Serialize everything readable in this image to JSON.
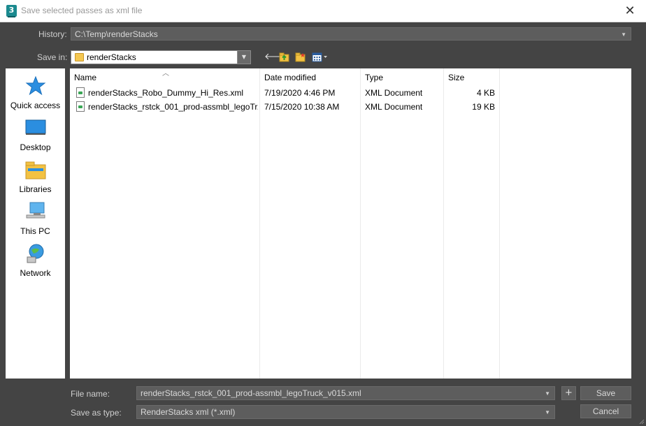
{
  "window": {
    "title": "Save selected passes as xml file",
    "close_glyph": "✕"
  },
  "history": {
    "label": "History:",
    "value": "C:\\Temp\\renderStacks"
  },
  "save_in": {
    "label": "Save in:",
    "value": "renderStacks"
  },
  "places": [
    {
      "label": "Quick access",
      "icon": "star-icon"
    },
    {
      "label": "Desktop",
      "icon": "desktop-icon"
    },
    {
      "label": "Libraries",
      "icon": "libraries-icon"
    },
    {
      "label": "This PC",
      "icon": "this-pc-icon"
    },
    {
      "label": "Network",
      "icon": "network-icon"
    }
  ],
  "columns": {
    "name": "Name",
    "date": "Date modified",
    "type": "Type",
    "size": "Size"
  },
  "files": [
    {
      "name": "renderStacks_Robo_Dummy_Hi_Res.xml",
      "date": "7/19/2020 4:46 PM",
      "type": "XML Document",
      "size": "4 KB"
    },
    {
      "name": "renderStacks_rstck_001_prod-assmbl_legoTr...",
      "date": "7/15/2020 10:38 AM",
      "type": "XML Document",
      "size": "19 KB"
    }
  ],
  "file_name": {
    "label": "File name:",
    "value": "renderStacks_rstck_001_prod-assmbl_legoTruck_v015.xml"
  },
  "save_as_type": {
    "label": "Save as type:",
    "value": "RenderStacks xml (*.xml)"
  },
  "buttons": {
    "save": "Save",
    "cancel": "Cancel",
    "plus": "+"
  },
  "colors": {
    "dialog_bg": "#444444",
    "field_bg": "#5d5d5d",
    "accent": "#1b8a8f"
  }
}
